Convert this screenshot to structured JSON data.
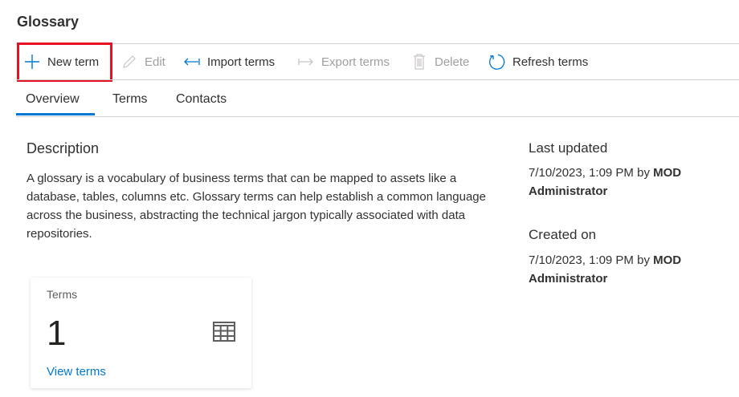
{
  "page": {
    "title": "Glossary"
  },
  "toolbar": {
    "new_term": "New term",
    "edit": "Edit",
    "import_terms": "Import terms",
    "export_terms": "Export terms",
    "delete": "Delete",
    "refresh_terms": "Refresh terms",
    "highlight_color": "#e81123"
  },
  "tabs": [
    {
      "label": "Overview",
      "active": true
    },
    {
      "label": "Terms"
    },
    {
      "label": "Contacts"
    }
  ],
  "description": {
    "heading": "Description",
    "text": "A glossary is a vocabulary of business terms that can be mapped to assets like a database, tables, columns etc. Glossary terms can help establish a common language across the business, abstracting the technical jargon typically associated with data repositories."
  },
  "meta": {
    "last_updated_label": "Last updated",
    "last_updated_value": "7/10/2023, 1:09 PM by ",
    "last_updated_user": "MOD Administrator",
    "created_on_label": "Created on",
    "created_on_value": "7/10/2023, 1:09 PM by ",
    "created_on_user": "MOD Administrator"
  },
  "card": {
    "label": "Terms",
    "count": "1",
    "link": "View terms",
    "icon": "table-icon"
  },
  "colors": {
    "accent": "#0078d4"
  }
}
